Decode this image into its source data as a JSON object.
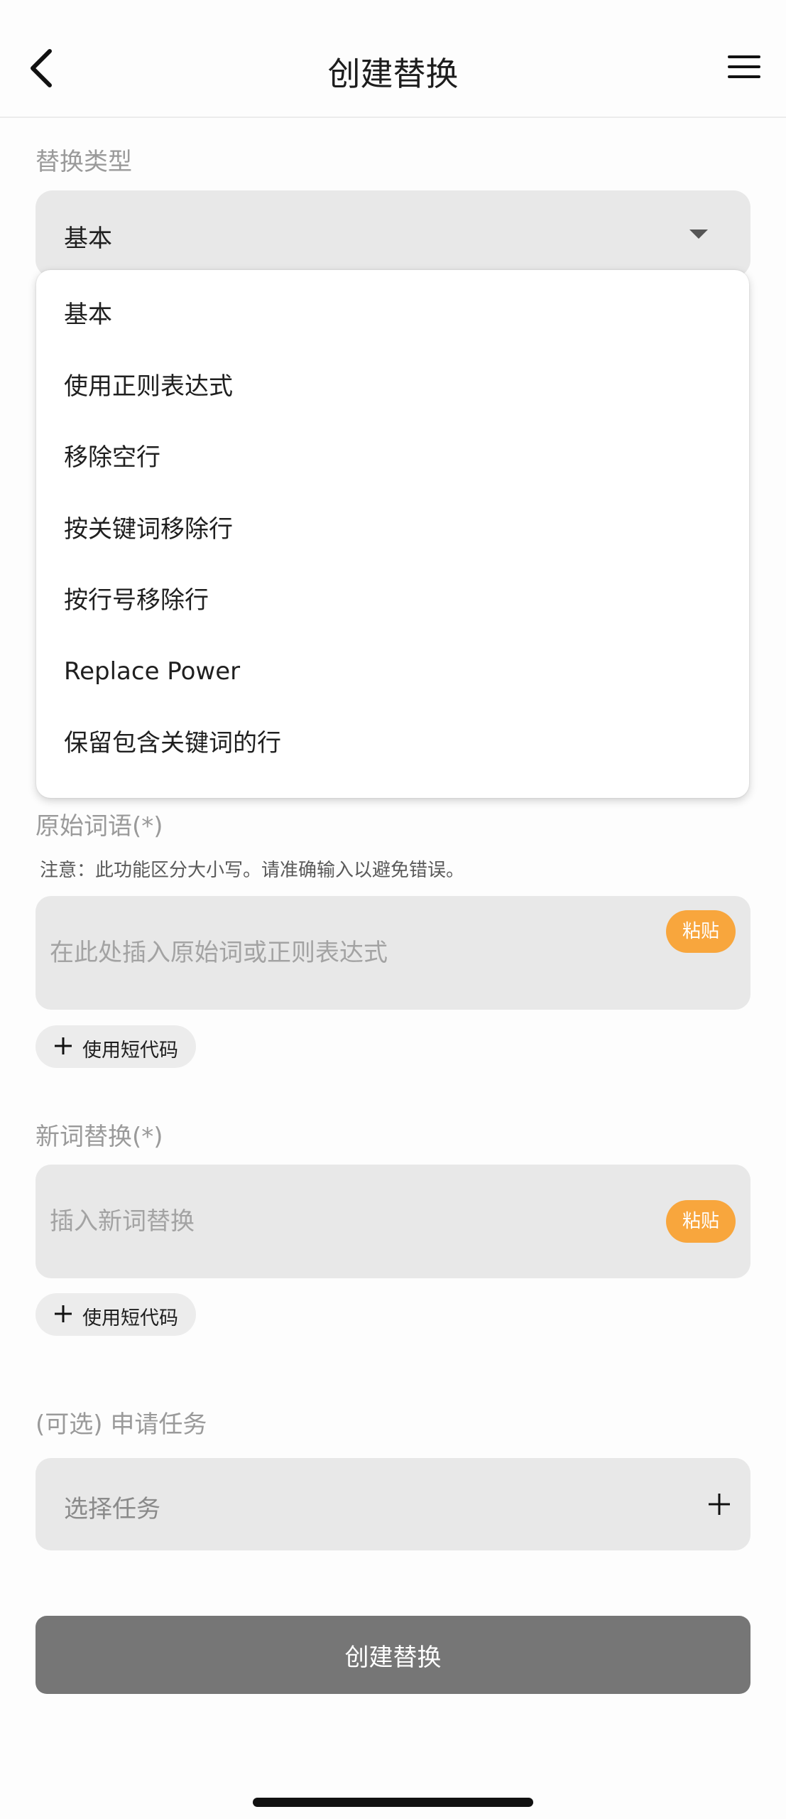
{
  "header": {
    "title": "创建替换",
    "back_icon": "chevron-left-icon",
    "menu_icon": "hamburger-menu-icon"
  },
  "replace_type": {
    "label": "替换类型",
    "selected": "基本",
    "options": [
      "基本",
      "使用正则表达式",
      "移除空行",
      "按关键词移除行",
      "按行号移除行",
      "Replace Power",
      "保留包含关键词的行"
    ]
  },
  "original_word": {
    "label": "原始词语(*)",
    "note": "注意：此功能区分大小写。请准确输入以避免错误。",
    "placeholder": "在此处插入原始词或正则表达式",
    "value": "",
    "paste_label": "粘贴",
    "shortcode_label": "使用短代码"
  },
  "new_word": {
    "label": "新词替换(*)",
    "placeholder": "插入新词替换",
    "value": "",
    "paste_label": "粘贴",
    "shortcode_label": "使用短代码"
  },
  "task": {
    "label": "(可选) 申请任务",
    "placeholder": "选择任务"
  },
  "submit_label": "创建替换",
  "colors": {
    "accent_paste": "#f8a63d",
    "submit_bg": "#767676",
    "field_bg": "#e8e8e8"
  }
}
